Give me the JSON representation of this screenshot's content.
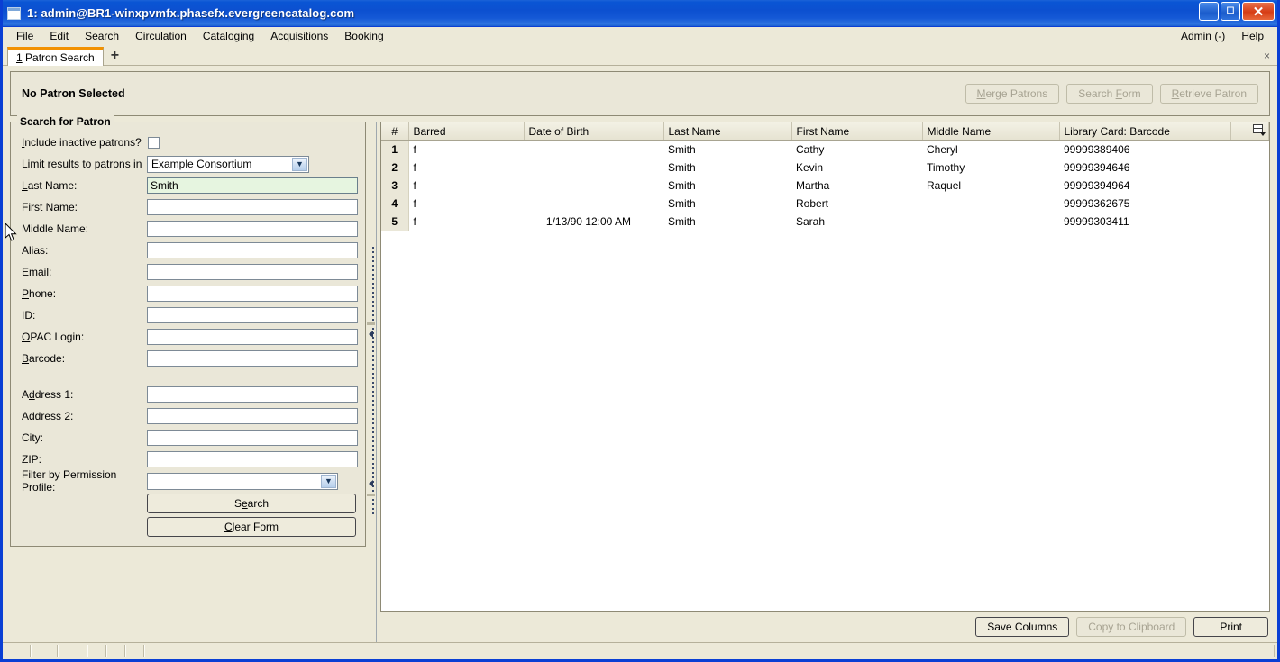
{
  "window": {
    "title": "1: admin@BR1-winxpvmfx.phasefx.evergreencatalog.com",
    "minimize_glyph": "_",
    "maximize_glyph": "☐",
    "close_glyph": "✕"
  },
  "menubar": {
    "items": [
      {
        "label": "File",
        "accel": "F"
      },
      {
        "label": "Edit",
        "accel": "E"
      },
      {
        "label": "Search",
        "accel": "c"
      },
      {
        "label": "Circulation",
        "accel": "C"
      },
      {
        "label": "Cataloging",
        "accel": "g"
      },
      {
        "label": "Acquisitions",
        "accel": "A"
      },
      {
        "label": "Booking",
        "accel": "B"
      }
    ],
    "right": [
      {
        "label": "Admin (-)",
        "accel": ""
      },
      {
        "label": "Help",
        "accel": "H"
      }
    ]
  },
  "tabs": {
    "active": "1 Patron Search",
    "add_label": "+",
    "close_label": "×"
  },
  "patron_header": {
    "status": "No Patron Selected",
    "buttons": [
      {
        "label": "Merge Patrons",
        "enabled": false
      },
      {
        "label": "Search Form",
        "enabled": false
      },
      {
        "label": "Retrieve Patron",
        "enabled": false
      }
    ]
  },
  "search_form": {
    "legend": "Search for Patron",
    "include_inactive_label": "Include inactive patrons?",
    "include_inactive_checked": false,
    "limit_results_label": "Limit results to patrons in",
    "limit_results_value": "Example Consortium",
    "fields": [
      {
        "label": "Last Name:",
        "value": "Smith",
        "active": true
      },
      {
        "label": "First Name:",
        "value": "",
        "active": false
      },
      {
        "label": "Middle Name:",
        "value": "",
        "active": false
      },
      {
        "label": "Alias:",
        "value": "",
        "active": false
      },
      {
        "label": "Email:",
        "value": "",
        "active": false
      },
      {
        "label": "Phone:",
        "value": "",
        "active": false
      },
      {
        "label": "ID:",
        "value": "",
        "active": false
      },
      {
        "label": "OPAC Login:",
        "value": "",
        "active": false
      },
      {
        "label": "Barcode:",
        "value": "",
        "active": false
      }
    ],
    "address_fields": [
      {
        "label": "Address 1:",
        "value": ""
      },
      {
        "label": "Address 2:",
        "value": ""
      },
      {
        "label": "City:",
        "value": ""
      },
      {
        "label": "ZIP:",
        "value": ""
      }
    ],
    "permission_profile_label": "Filter by Permission Profile:",
    "permission_profile_value": "",
    "search_button": "Search",
    "clear_button": "Clear Form"
  },
  "results": {
    "columns": [
      "#",
      "Barred",
      "Date of Birth",
      "Last Name",
      "First Name",
      "Middle Name",
      "Library Card: Barcode"
    ],
    "rows": [
      {
        "num": "1",
        "barred": "f",
        "dob": "",
        "last": "Smith",
        "first": "Cathy",
        "middle": "Cheryl",
        "barcode": "99999389406"
      },
      {
        "num": "2",
        "barred": "f",
        "dob": "",
        "last": "Smith",
        "first": "Kevin",
        "middle": "Timothy",
        "barcode": "99999394646"
      },
      {
        "num": "3",
        "barred": "f",
        "dob": "",
        "last": "Smith",
        "first": "Martha",
        "middle": "Raquel",
        "barcode": "99999394964"
      },
      {
        "num": "4",
        "barred": "f",
        "dob": "",
        "last": "Smith",
        "first": "Robert",
        "middle": "",
        "barcode": "99999362675"
      },
      {
        "num": "5",
        "barred": "f",
        "dob": "1/13/90 12:00 AM",
        "last": "Smith",
        "first": "Sarah",
        "middle": "",
        "barcode": "99999303411"
      }
    ],
    "footer_buttons": [
      {
        "label": "Save Columns",
        "enabled": true
      },
      {
        "label": "Copy to Clipboard",
        "enabled": false
      },
      {
        "label": "Print",
        "enabled": true
      }
    ]
  },
  "statusbar": {
    "cells": [
      "",
      "",
      "",
      "",
      "",
      "",
      ""
    ]
  },
  "colors": {
    "title_bar": "#0a55d4",
    "window_border": "#0a3fd4",
    "panel_bg": "#eae7d8",
    "chrome_bg": "#ece9d8",
    "tab_accent": "#f29100",
    "active_field_bg": "#e6f5e0"
  }
}
